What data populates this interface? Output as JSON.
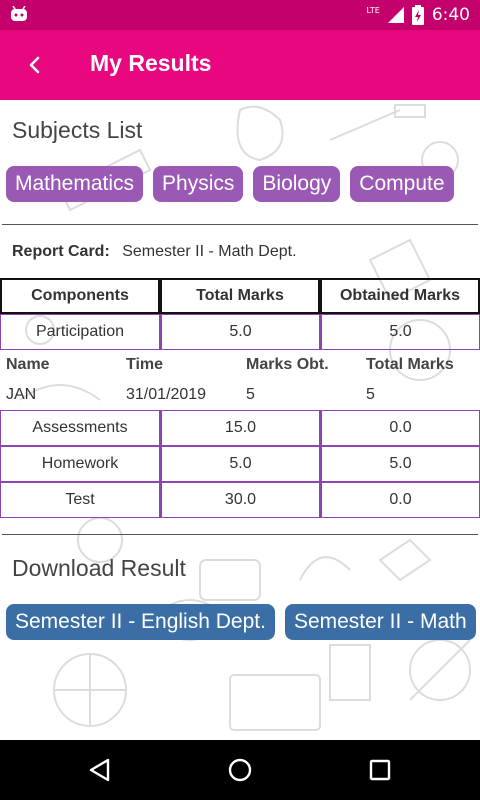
{
  "status_bar": {
    "time": "6:40",
    "network": "LTE"
  },
  "app_bar": {
    "title": "My Results"
  },
  "subjects": {
    "title": "Subjects List",
    "items": [
      "Mathematics",
      "Physics",
      "Biology",
      "Compute"
    ]
  },
  "report": {
    "label": "Report Card:",
    "value": "Semester II - Math Dept.",
    "headers": [
      "Components",
      "Total Marks",
      "Obtained Marks"
    ],
    "participation": [
      "Participation",
      "5.0",
      "5.0"
    ],
    "detail_headers": [
      "Name",
      "Time",
      "Marks Obt.",
      "Total Marks"
    ],
    "detail_row": [
      "JAN",
      "31/01/2019",
      "5",
      "5"
    ],
    "rows": [
      [
        "Assessments",
        "15.0",
        "0.0"
      ],
      [
        "Homework",
        "5.0",
        "5.0"
      ],
      [
        "Test",
        "30.0",
        "0.0"
      ]
    ]
  },
  "download": {
    "title": "Download Result",
    "items": [
      "Semester II - English Dept.",
      "Semester II - Math"
    ]
  },
  "colors": {
    "status_bar": "#c4006c",
    "app_bar": "#e8077f",
    "chip_purple": "#9b59b6",
    "chip_blue": "#3a6ea5",
    "table_border": "#8e44ad"
  },
  "icons": [
    "android-icon",
    "lte-signal-icon",
    "battery-icon",
    "back-icon",
    "nav-back-icon",
    "nav-home-icon",
    "nav-recents-icon"
  ]
}
